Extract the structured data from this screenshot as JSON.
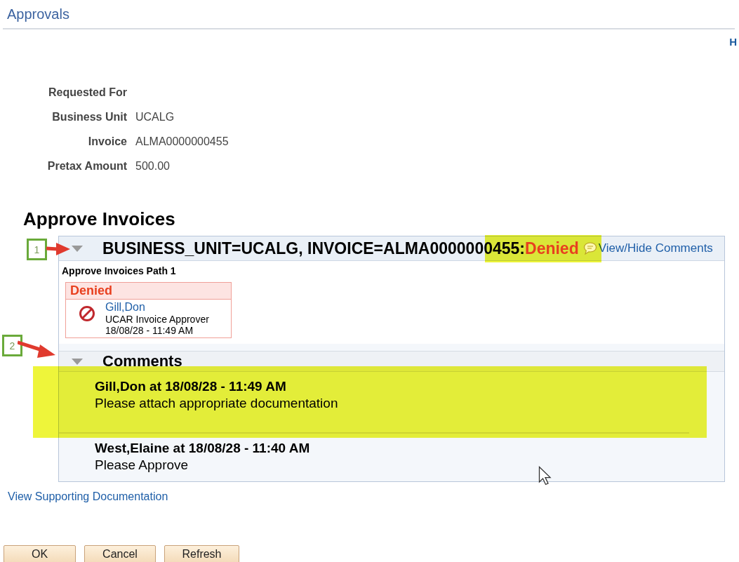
{
  "page": {
    "title": "Approvals",
    "help_link": "H"
  },
  "summary": [
    {
      "label": "Requested For"
    },
    {
      "label": "Business Unit",
      "value": "UCALG"
    },
    {
      "label": "Invoice",
      "value": "ALMA0000000455"
    },
    {
      "label": "Pretax Amount",
      "value": "500.00"
    }
  ],
  "section_title": "Approve Invoices",
  "approval": {
    "expanded": true,
    "highlighted": true,
    "heading": "BUSINESS_UNIT=UCALG, INVOICE=ALMA0000000455:",
    "status": "Denied",
    "comments_link": "View/Hide Comments",
    "path_title": "Approve Invoices Path 1",
    "step": {
      "status": "Denied",
      "approver": "Gill,Don",
      "role": "UCAR Invoice Approver",
      "time": "18/08/28 - 11:49 AM"
    }
  },
  "comments": {
    "title": "Comments",
    "expanded": true,
    "items": [
      {
        "author_line": "Gill,Don at 18/08/28 - 11:49 AM",
        "text": "Please attach appropriate documentation",
        "highlighted": true
      },
      {
        "author_line": "West,Elaine at 18/08/28 - 11:40 AM",
        "text": "Please Approve",
        "highlighted": false
      }
    ]
  },
  "link": "View Supporting Documentation",
  "buttons": [
    "OK",
    "Cancel",
    "Refresh"
  ],
  "callouts": [
    {
      "label": "1"
    },
    {
      "label": "2"
    }
  ]
}
